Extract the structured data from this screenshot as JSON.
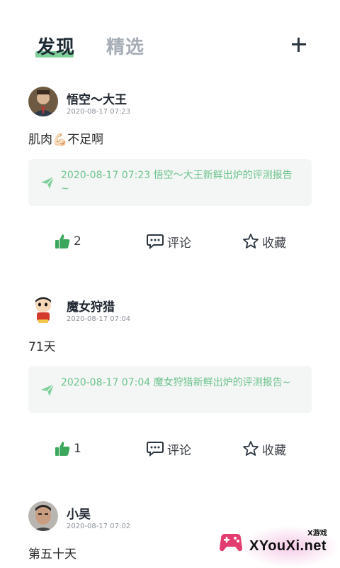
{
  "header": {
    "tab_active": "发现",
    "tab_inactive": "精选",
    "add_label": "+"
  },
  "posts": [
    {
      "username": "悟空～大王",
      "time": "2020-08-17 07:23",
      "content": "肌肉💪🏻不足啊",
      "report": "2020-08-17 07:23   悟空～大王新鲜出炉的评测报告~",
      "likes": "2",
      "comment_label": "评论",
      "fav_label": "收藏"
    },
    {
      "username": "魔女狩猎",
      "time": "2020-08-17 07:04",
      "content": "71天",
      "report": "2020-08-17 07:04   魔女狩猎新鲜出炉的评测报告~",
      "likes": "1",
      "comment_label": "评论",
      "fav_label": "收藏"
    },
    {
      "username": "小吴",
      "time": "2020-08-17 07:02",
      "content": "第五十天"
    }
  ],
  "watermark": {
    "small": "X游戏",
    "big": "XYouXi.net"
  },
  "colors": {
    "accent": "#6cc38d",
    "like_green": "#3aa75a"
  }
}
